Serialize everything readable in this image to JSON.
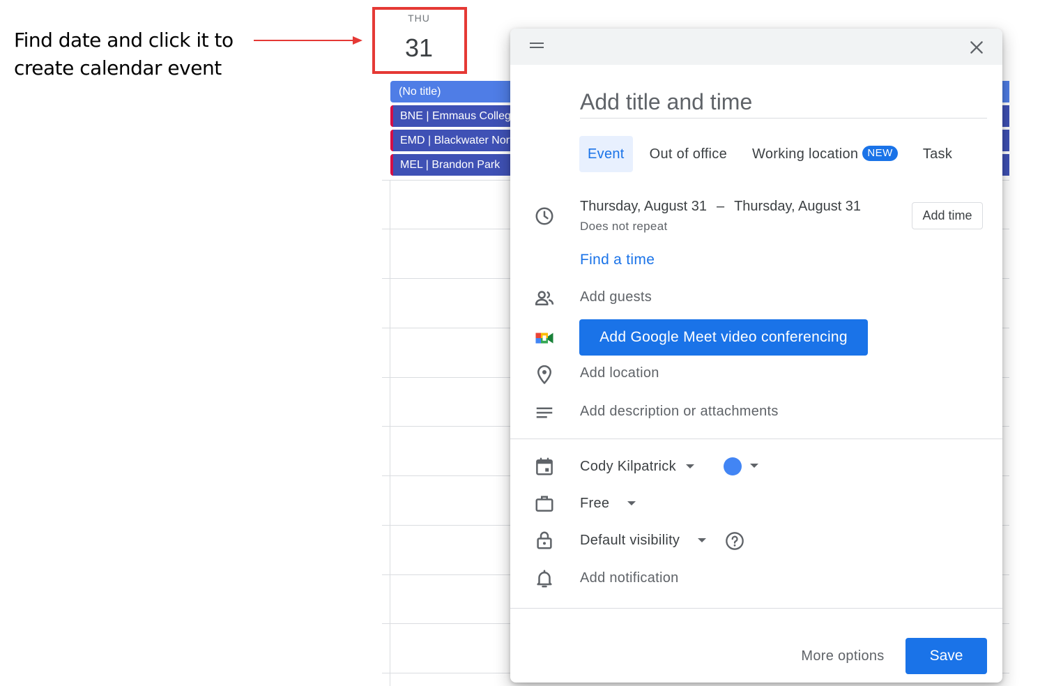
{
  "annotation": {
    "line1": "Find date and click it to",
    "line2": "create calendar event",
    "arrow_color": "#e53935",
    "box_color": "#e53935"
  },
  "day_header": {
    "weekday": "THU",
    "day_number": "31"
  },
  "calendar_events": [
    {
      "label": "(No title)",
      "style": "light"
    },
    {
      "label": "BNE | Emmaus College",
      "style": "dark"
    },
    {
      "label": "EMD | Blackwater North",
      "style": "dark"
    },
    {
      "label": "MEL | Brandon Park",
      "style": "dark"
    }
  ],
  "dialog": {
    "title_placeholder": "Add title and time",
    "tabs": {
      "event": "Event",
      "out_of_office": "Out of office",
      "working_location": "Working location",
      "new_badge": "NEW",
      "task": "Task"
    },
    "date_start": "Thursday, August 31",
    "date_separator": "–",
    "date_end": "Thursday, August 31",
    "repeat": "Does not repeat",
    "add_time": "Add time",
    "find_time": "Find a time",
    "add_guests": "Add guests",
    "meet_button": "Add Google Meet video conferencing",
    "add_location": "Add location",
    "add_description": "Add description or attachments",
    "calendar_owner": "Cody Kilpatrick",
    "calendar_color": "#4285f4",
    "availability": "Free",
    "visibility": "Default visibility",
    "add_notification": "Add notification",
    "more_options": "More options",
    "save": "Save",
    "accent_color": "#1a73e8"
  },
  "icons": {
    "drag": "drag-handle-icon",
    "close": "close-icon",
    "clock": "clock-icon",
    "guests": "people-icon",
    "meet": "google-meet-icon",
    "location": "location-pin-icon",
    "description": "notes-icon",
    "calendar": "calendar-icon",
    "briefcase": "briefcase-icon",
    "lock": "lock-icon",
    "bell": "bell-icon",
    "help": "help-icon"
  }
}
